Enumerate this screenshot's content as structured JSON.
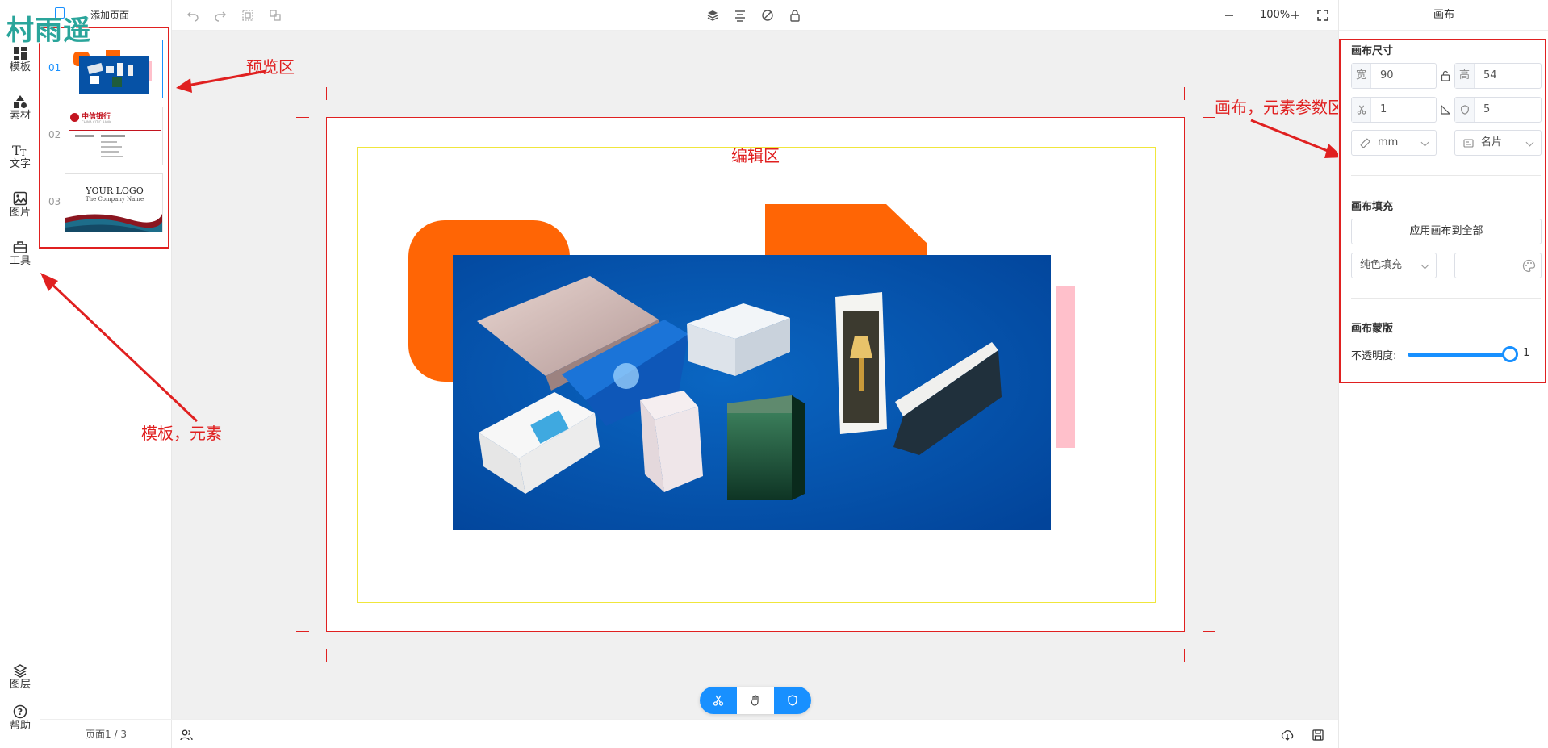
{
  "logo": {
    "text": "村雨遥"
  },
  "rail": {
    "items": [
      {
        "label": "模板",
        "icon": "template-icon"
      },
      {
        "label": "素材",
        "icon": "shapes-icon"
      },
      {
        "label": "文字",
        "icon": "text-icon"
      },
      {
        "label": "图片",
        "icon": "image-icon"
      },
      {
        "label": "工具",
        "icon": "toolbox-icon"
      }
    ],
    "bottom_items": [
      {
        "label": "图层",
        "icon": "layers-icon"
      },
      {
        "label": "帮助",
        "icon": "help-icon"
      }
    ]
  },
  "pages": {
    "add_label": "添加页面",
    "items": [
      {
        "num": "01",
        "active": true
      },
      {
        "num": "02",
        "active": false
      },
      {
        "num": "03",
        "active": false
      }
    ],
    "thumb2": {
      "bank": "中信银行",
      "sub": "CHINA CITIC BANK"
    },
    "thumb3": {
      "logo": "YOUR LOGO",
      "company": "The Company Name"
    },
    "footer": "页面1 / 3"
  },
  "toolbar": {
    "zoom": "100%"
  },
  "annotations": {
    "preview": "预览区",
    "edit": "编辑区",
    "templates": "模板，元素",
    "params": "画布，元素参数区"
  },
  "panel": {
    "title": "画布",
    "size_section": "画布尺寸",
    "width_label": "宽",
    "width_value": "90",
    "height_label": "高",
    "height_value": "54",
    "bleed_value": "1",
    "safe_value": "5",
    "unit": "mm",
    "preset": "名片",
    "fill_section": "画布填充",
    "apply_all": "应用画布到全部",
    "fill_type": "纯色填充",
    "mask_section": "画布蒙版",
    "opacity_label": "不透明度:",
    "opacity_value": "1",
    "opacity_level": 1.0
  },
  "colors": {
    "accent": "#1890ff",
    "annotation": "#e02020",
    "orange": "#ff6505",
    "pink": "#ffc0cb",
    "product_bg": "#0652a6"
  }
}
